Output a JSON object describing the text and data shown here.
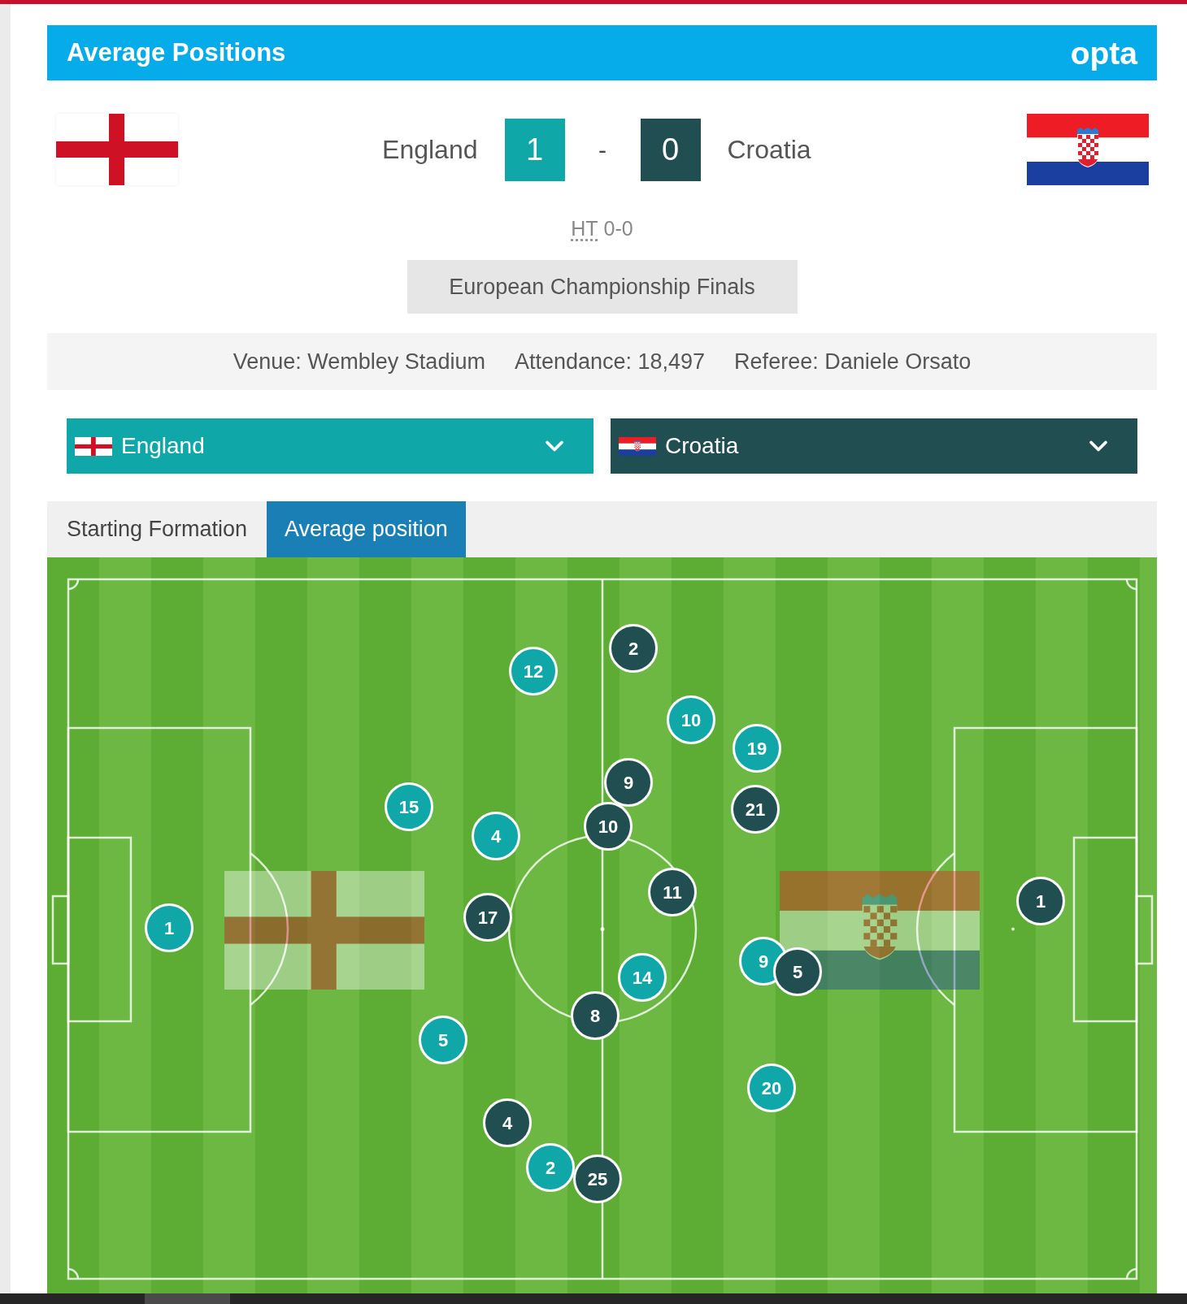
{
  "header": {
    "title": "Average Positions",
    "logo": "opta"
  },
  "match": {
    "teams": [
      {
        "name": "England",
        "score": "1",
        "color": "#0fa7a8"
      },
      {
        "name": "Croatia",
        "score": "0",
        "color": "#214f51"
      }
    ],
    "separator": "-",
    "half_time": {
      "label": "HT",
      "score": "0-0"
    },
    "competition": "European Championship Finals"
  },
  "details": [
    "Venue: Wembley Stadium",
    "Attendance: 18,497",
    "Referee: Daniele Orsato"
  ],
  "team_selectors": [
    {
      "label": "England"
    },
    {
      "label": "Croatia"
    }
  ],
  "tabs": [
    {
      "label": "Starting Formation",
      "selected": false
    },
    {
      "label": "Average position",
      "selected": true
    }
  ],
  "pitch": {
    "teams": [
      {
        "players": [
          {
            "number": "12"
          },
          {
            "number": "10"
          },
          {
            "number": "19"
          },
          {
            "number": "15"
          },
          {
            "number": "4"
          },
          {
            "number": "1"
          },
          {
            "number": "14"
          },
          {
            "number": "9"
          },
          {
            "number": "5"
          },
          {
            "number": "20"
          },
          {
            "number": "2"
          }
        ]
      },
      {
        "players": [
          {
            "number": "2"
          },
          {
            "number": "9"
          },
          {
            "number": "21"
          },
          {
            "number": "10"
          },
          {
            "number": "11"
          },
          {
            "number": "17"
          },
          {
            "number": "5"
          },
          {
            "number": "8"
          },
          {
            "number": "4"
          },
          {
            "number": "25"
          },
          {
            "number": "1"
          }
        ]
      }
    ]
  }
}
